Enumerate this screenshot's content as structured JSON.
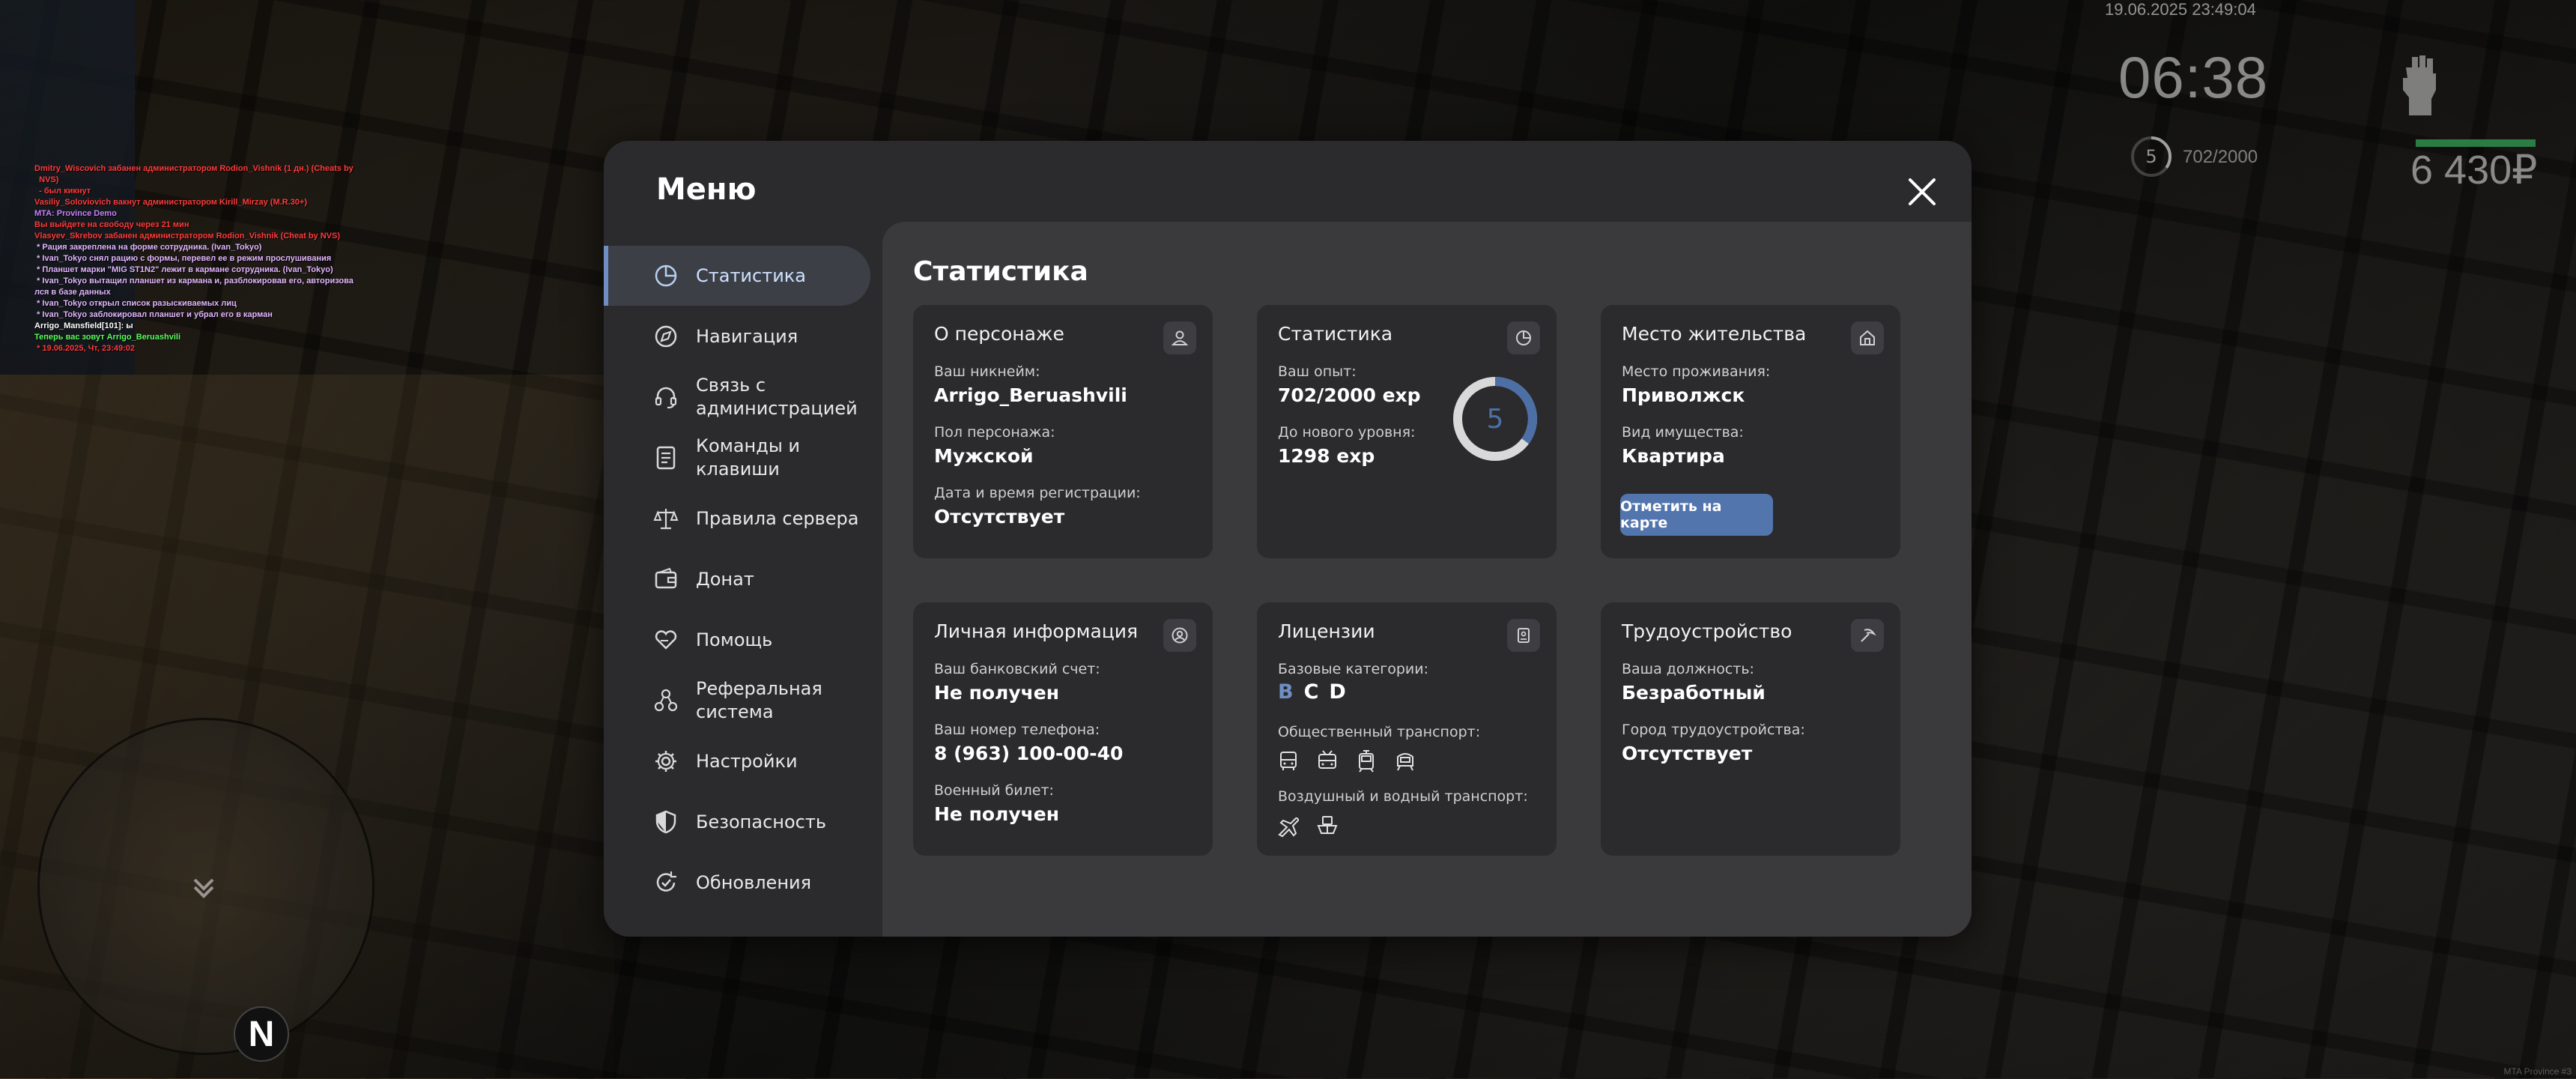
{
  "chat": [
    {
      "text": "Dmitry_Wiscovich забанен администратором Rodion_Vishnik (1 дн.) (Cheats by",
      "color": "#ff3b3b"
    },
    {
      "text": "  NVS)",
      "color": "#ff3b3b"
    },
    {
      "text": "  - был кикнут",
      "color": "#ff3b3b"
    },
    {
      "text": "Vasiliy_Soloviovich вакнут администратором Kirill_Mirzay (M.R.30+)",
      "color": "#ff3b3b"
    },
    {
      "text": "MTA: Province Demo",
      "color": "#c980ff"
    },
    {
      "text": "Вы выйдете на свободу через 21 мин",
      "color": "#ff3b3b"
    },
    {
      "text": "Vlasyev_Skrebov забанен администратором Rodion_Vishnik (Cheat by NVS)",
      "color": "#ff3b3b"
    },
    {
      "text": " * Рация закреплена на форме сотрудника. (Ivan_Tokyo)",
      "color": "#e3b7ff"
    },
    {
      "text": " * Ivan_Tokyo снял рацию с формы, перевел ее в режим прослушивания",
      "color": "#e3b7ff"
    },
    {
      "text": " * Планшет марки \"MIG ST1N2\" лежит в кармане сотрудника. (Ivan_Tokyo)",
      "color": "#e3b7ff"
    },
    {
      "text": " * Ivan_Tokyo вытащил планшет из кармана и, разблокировав его, авторизова",
      "color": "#e3b7ff"
    },
    {
      "text": "лся в базе данных",
      "color": "#e3b7ff"
    },
    {
      "text": " * Ivan_Tokyo открыл список разыскиваемых лиц",
      "color": "#e3b7ff"
    },
    {
      "text": " * Ivan_Tokyo заблокировал планшет и убрал его в карман",
      "color": "#e3b7ff"
    },
    {
      "text": "Arrigo_Mansfield[101]: ы",
      "color": "#ffffff"
    },
    {
      "text": "Теперь вас зовут Arrigo_Beruashvili",
      "color": "#5cff5c"
    },
    {
      "text": " * 19.06.2025, Чт, 23:49:02",
      "color": "#ff3b3b"
    }
  ],
  "hud": {
    "date": "19.06.2025 23:49:04",
    "time": "06:38",
    "level": "5",
    "exp": "702/2000",
    "money": "6 430₽"
  },
  "radar": {
    "north": "N"
  },
  "watermark": "MTA Province #3",
  "menu": {
    "title": "Меню",
    "sidebar": [
      {
        "label": "Статистика",
        "icon": "pie-chart-icon",
        "active": true
      },
      {
        "label": "Навигация",
        "icon": "compass-icon"
      },
      {
        "label": "Связь с администрацией",
        "icon": "headset-icon"
      },
      {
        "label": "Команды и клавиши",
        "icon": "keyboard-list-icon"
      },
      {
        "label": "Правила сервера",
        "icon": "scales-icon"
      },
      {
        "label": "Донат",
        "icon": "wallet-icon"
      },
      {
        "label": "Помощь",
        "icon": "heart-hand-icon"
      },
      {
        "label": "Реферальная система",
        "icon": "referral-icon"
      },
      {
        "label": "Настройки",
        "icon": "gear-icon"
      },
      {
        "label": "Безопасность",
        "icon": "shield-icon"
      },
      {
        "label": "Обновления",
        "icon": "update-icon"
      }
    ]
  },
  "content": {
    "title": "Статистика",
    "character": {
      "title": "О персонаже",
      "nick_label": "Ваш никнейм:",
      "nick": "Arrigo_Beruashvili",
      "gender_label": "Пол персонажа:",
      "gender": "Мужской",
      "reg_label": "Дата и время регистрации:",
      "reg": "Отсутствует"
    },
    "stats": {
      "title": "Статистика",
      "exp_label": "Ваш опыт:",
      "exp": "702/2000 exp",
      "next_label": "До нового уровня:",
      "next": "1298 exp",
      "level": "5",
      "progress": 0.351,
      "ring_color": "#4c6fa5"
    },
    "residence": {
      "title": "Место жительства",
      "place_label": "Место проживания:",
      "place": "Приволжск",
      "type_label": "Вид имущества:",
      "type": "Квартира",
      "map_button": "Отметить на карте"
    },
    "personal": {
      "title": "Личная информация",
      "bank_label": "Ваш банковский счет:",
      "bank": "Не получен",
      "phone_label": "Ваш номер телефона:",
      "phone": "8 (963) 100-00-40",
      "military_label": "Военный билет:",
      "military": "Не получен"
    },
    "licenses": {
      "title": "Лицензии",
      "base_label": "Базовые категории:",
      "categories": [
        {
          "letter": "B",
          "color": "#6f8fc4"
        },
        {
          "letter": "C",
          "color": "#ffffff"
        },
        {
          "letter": "D",
          "color": "#ffffff"
        }
      ],
      "public_label": "Общественный транспорт:",
      "air_label": "Воздушный и водный транспорт:"
    },
    "employment": {
      "title": "Трудоустройство",
      "position_label": "Ваша должность:",
      "position": "Безработный",
      "city_label": "Город трудоустройства:",
      "city": "Отсутствует"
    }
  }
}
